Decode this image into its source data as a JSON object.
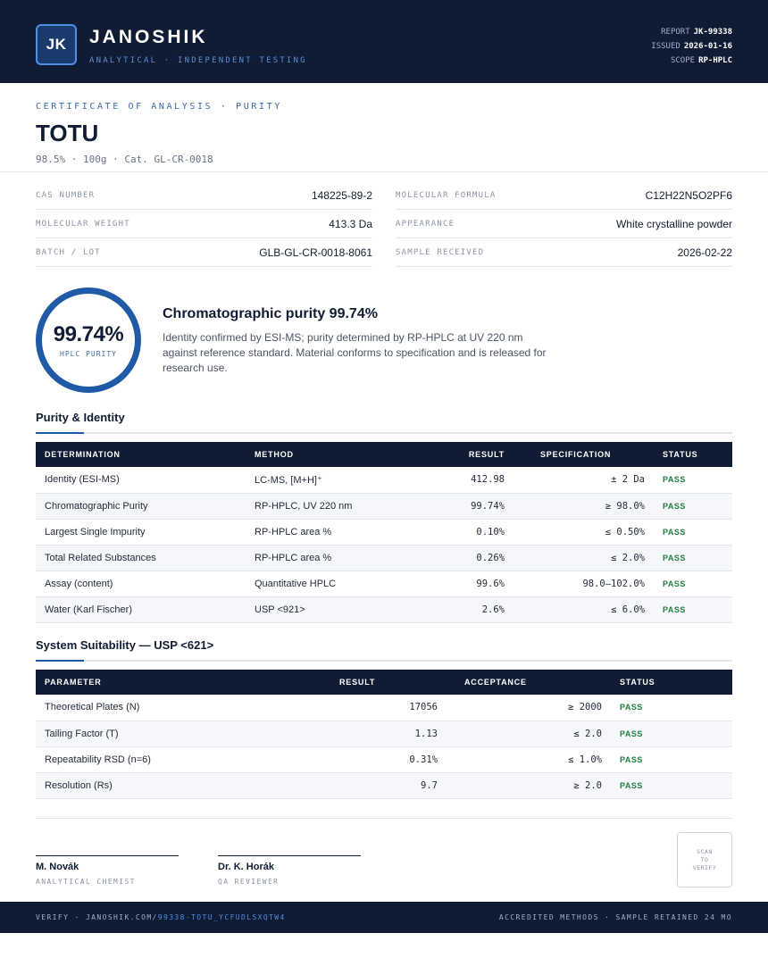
{
  "header": {
    "logo_initials": "JK",
    "brand": "JANOSHIK",
    "tagline": "ANALYTICAL · INDEPENDENT TESTING",
    "report_label": "REPORT",
    "report_value": "JK-99338",
    "issued_label": "ISSUED",
    "issued_value": "2026-01-16",
    "scope_label": "SCOPE",
    "scope_value": "RP-HPLC"
  },
  "title": {
    "cert_label": "CERTIFICATE OF ANALYSIS · PURITY",
    "product": "TOTU",
    "subtitle": "98.5% · 100g  ·  Cat. GL-CR-0018"
  },
  "properties": {
    "left": [
      {
        "label": "CAS NUMBER",
        "value": "148225-89-2"
      },
      {
        "label": "MOLECULAR WEIGHT",
        "value": "413.3 Da"
      },
      {
        "label": "BATCH / LOT",
        "value": "GLB-GL-CR-0018-8061"
      }
    ],
    "right": [
      {
        "label": "MOLECULAR FORMULA",
        "value": "C12H22N5O2PF6"
      },
      {
        "label": "APPEARANCE",
        "value": "White crystalline powder"
      },
      {
        "label": "SAMPLE RECEIVED",
        "value": "2026-02-22"
      }
    ]
  },
  "summary": {
    "purity_value": "99.74%",
    "purity_label": "HPLC PURITY",
    "purity_fraction": 0.9974,
    "headline": "Chromatographic purity 99.74%",
    "text": "Identity confirmed by ESI-MS; purity determined by RP-HPLC at UV 220 nm against reference standard. Material conforms to specification and is released for research use."
  },
  "purity_section": {
    "title": "Purity & Identity",
    "headers": [
      "DETERMINATION",
      "METHOD",
      "RESULT",
      "SPECIFICATION",
      "STATUS"
    ],
    "rows": [
      {
        "determination": "Identity (ESI-MS)",
        "method": "LC-MS, [M+H]⁺",
        "result": "412.98",
        "spec": "± 2 Da",
        "status": "PASS"
      },
      {
        "determination": "Chromatographic Purity",
        "method": "RP-HPLC, UV 220 nm",
        "result": "99.74%",
        "spec": "≥ 98.0%",
        "status": "PASS"
      },
      {
        "determination": "Largest Single Impurity",
        "method": "RP-HPLC area %",
        "result": "0.10%",
        "spec": "≤ 0.50%",
        "status": "PASS"
      },
      {
        "determination": "Total Related Substances",
        "method": "RP-HPLC area %",
        "result": "0.26%",
        "spec": "≤ 2.0%",
        "status": "PASS"
      },
      {
        "determination": "Assay (content)",
        "method": "Quantitative HPLC",
        "result": "99.6%",
        "spec": "98.0–102.0%",
        "status": "PASS"
      },
      {
        "determination": "Water (Karl Fischer)",
        "method": "USP <921>",
        "result": "2.6%",
        "spec": "≤ 6.0%",
        "status": "PASS"
      }
    ]
  },
  "suitability_section": {
    "title": "System Suitability — USP <621>",
    "headers": [
      "PARAMETER",
      "RESULT",
      "ACCEPTANCE",
      "STATUS"
    ],
    "rows": [
      {
        "parameter": "Theoretical Plates (N)",
        "result": "17056",
        "acceptance": "≥ 2000",
        "status": "PASS"
      },
      {
        "parameter": "Tailing Factor (T)",
        "result": "1.13",
        "acceptance": "≤ 2.0",
        "status": "PASS"
      },
      {
        "parameter": "Repeatability RSD (n=6)",
        "result": "0.31%",
        "acceptance": "≤ 1.0%",
        "status": "PASS"
      },
      {
        "parameter": "Resolution (Rs)",
        "result": "9.7",
        "acceptance": "≥ 2.0",
        "status": "PASS"
      }
    ]
  },
  "signatures": [
    {
      "name": "M. Novák",
      "role": "ANALYTICAL CHEMIST"
    },
    {
      "name": "Dr. K. Horák",
      "role": "QA REVIEWER"
    }
  ],
  "qr": {
    "line1": "SCAN",
    "line2": "TO",
    "line3": "VERIFY"
  },
  "footer": {
    "verify_prefix": "VERIFY · JANOSHIK.COM/",
    "verify_link": "99338-TOTU_YCFUDLSXQTW4",
    "right_text": "ACCREDITED METHODS · SAMPLE RETAINED 24 MO"
  },
  "colors": {
    "navy": "#0f1c33",
    "accent": "#1f5aa6",
    "pass": "#1e8040"
  }
}
